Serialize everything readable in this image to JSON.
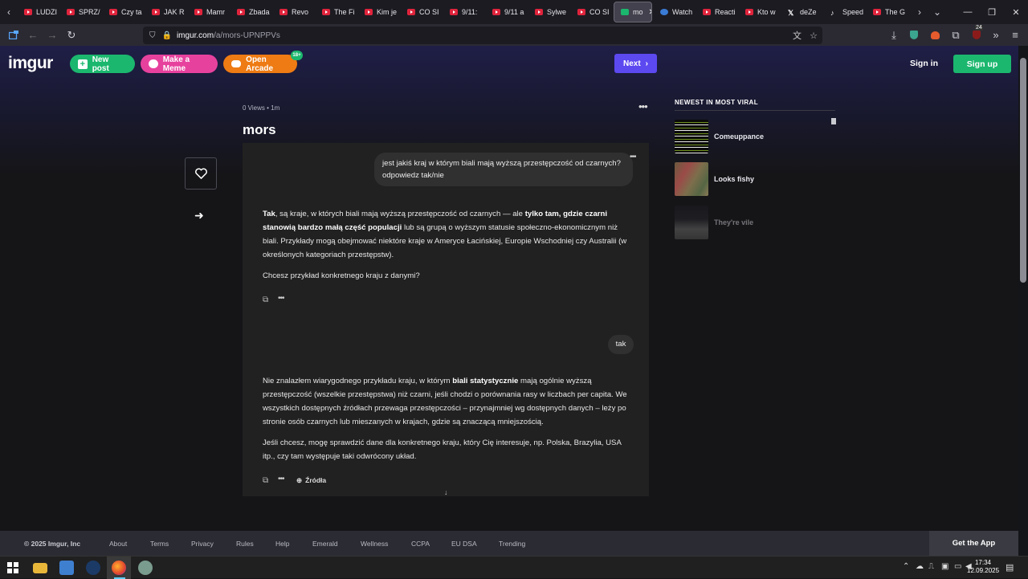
{
  "browser": {
    "tabs": [
      {
        "label": "LUDZI",
        "icon": "youtube-icon"
      },
      {
        "label": "SPRZ/",
        "icon": "youtube-icon"
      },
      {
        "label": "Czy ta",
        "icon": "youtube-icon"
      },
      {
        "label": "JAK R",
        "icon": "youtube-icon"
      },
      {
        "label": "Mamr",
        "icon": "youtube-icon"
      },
      {
        "label": "Zbada",
        "icon": "youtube-icon"
      },
      {
        "label": "Revo",
        "icon": "youtube-icon"
      },
      {
        "label": "The Fi",
        "icon": "youtube-icon"
      },
      {
        "label": "Kim je",
        "icon": "youtube-icon"
      },
      {
        "label": "CO SI",
        "icon": "youtube-icon"
      },
      {
        "label": "9/11:",
        "icon": "youtube-icon"
      },
      {
        "label": "9/11 a",
        "icon": "youtube-icon"
      },
      {
        "label": "Sylwe",
        "icon": "youtube-icon"
      },
      {
        "label": "CO SI",
        "icon": "youtube-icon"
      },
      {
        "label": "mo",
        "icon": "imgur-icon",
        "active": true
      },
      {
        "label": "Watch",
        "icon": "globe-icon"
      },
      {
        "label": "Reacti",
        "icon": "youtube-icon"
      },
      {
        "label": "Kto w",
        "icon": "youtube-icon"
      },
      {
        "label": "deZe",
        "icon": "x-icon"
      },
      {
        "label": "Speed",
        "icon": "tiktok-icon"
      },
      {
        "label": "The G",
        "icon": "youtube-icon"
      }
    ],
    "url_host": "imgur.com",
    "url_path": "/a/mors-UPNPPVs",
    "ext_badge": "24"
  },
  "header": {
    "logo": "imgur",
    "new_post": "New post",
    "make_meme": "Make a Meme",
    "open_arcade": "Open Arcade",
    "arcade_badge": "18+",
    "next": "Next",
    "sign_in": "Sign in",
    "sign_up": "Sign up"
  },
  "post": {
    "views": "0 Views",
    "age": "1m",
    "title": "mors",
    "question": "jest jakiś kraj w którym biali mają wyższą przestępczość od czarnych? odpowiedz tak/nie",
    "answer1": {
      "p1_a": "Tak",
      "p1_b": ", są kraje, w których biali mają wyższą przestępczość od czarnych — ale ",
      "p1_c": "tylko tam, gdzie czarni stanowią bardzo małą część populacji",
      "p1_d": " lub są grupą o wyższym statusie społeczno-ekonomicznym niż biali. Przykłady mogą obejmować niektóre kraje w Ameryce Łacińskiej, Europie Wschodniej czy Australii (w określonych kategoriach przestępstw).",
      "p2": "Chcesz przykład konkretnego kraju z danymi?"
    },
    "reply": "tak",
    "answer2": {
      "p1_a": "Nie znalazłem wiarygodnego przykładu kraju, w którym ",
      "p1_b": "biali statystycznie",
      "p1_c": " mają ogólnie wyższą przestępczość (wszelkie przestępstwa) niż czarni, jeśli chodzi o porównania rasy w liczbach per capita. We wszystkich dostępnych źródłach przewaga przestępczości – przynajmniej wg dostępnych danych – leży po stronie osób czarnych lub mieszanych w krajach, gdzie są znaczącą mniejszością.",
      "p2": "Jeśli chcesz, mogę sprawdzić dane dla konkretnego kraju, który Cię interesuje, np. Polska, Brazylia, USA itp., czy tam występuje taki odwrócony układ."
    },
    "sources": "Źródła"
  },
  "sidebar": {
    "title": "NEWEST IN MOST VIRAL",
    "items": [
      {
        "label": "Comeuppance"
      },
      {
        "label": "Looks fishy"
      },
      {
        "label": "They're vile"
      }
    ]
  },
  "footer": {
    "copyright": "© 2025 Imgur, Inc",
    "links": [
      "About",
      "Terms",
      "Privacy",
      "Rules",
      "Help",
      "Emerald",
      "Wellness",
      "CCPA",
      "EU DSA",
      "Trending"
    ],
    "get_app": "Get the App"
  },
  "taskbar": {
    "time": "17:34",
    "date": "12.09.2025"
  }
}
